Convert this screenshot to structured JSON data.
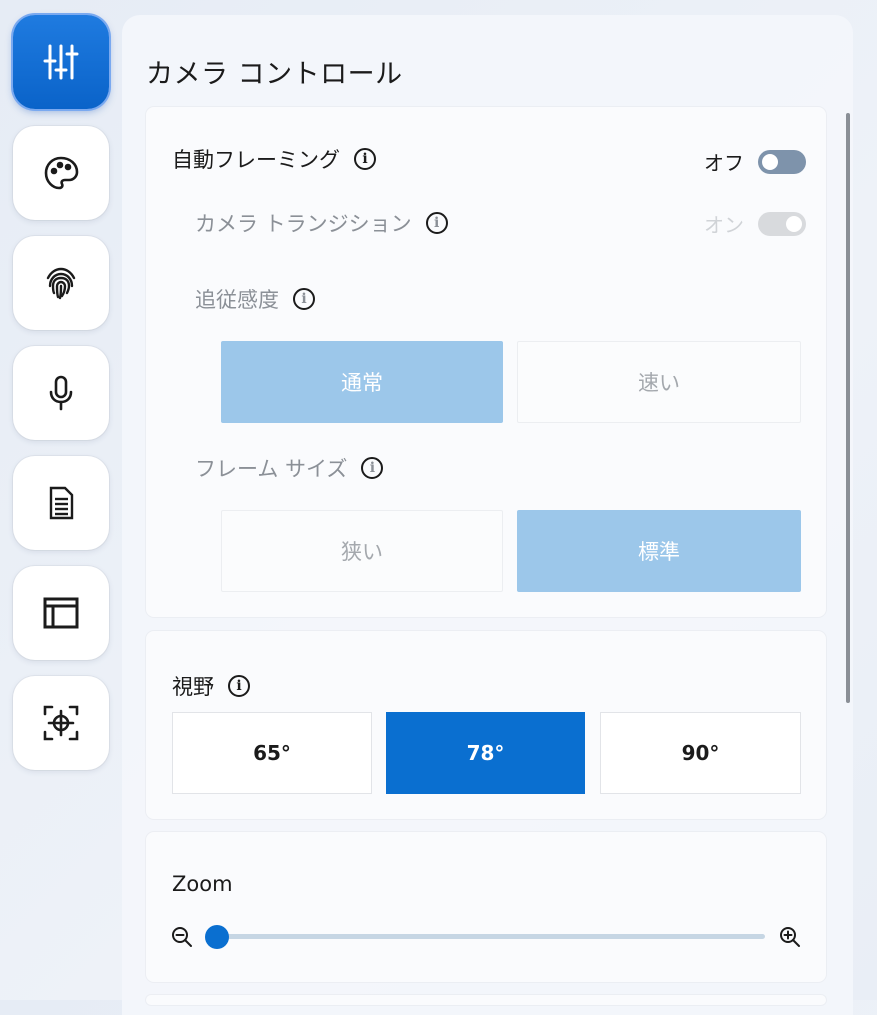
{
  "rail": {
    "items": [
      {
        "icon": "sliders-icon",
        "active": true
      },
      {
        "icon": "palette-icon",
        "active": false
      },
      {
        "icon": "fingerprint-icon",
        "active": false
      },
      {
        "icon": "microphone-icon",
        "active": false
      },
      {
        "icon": "document-icon",
        "active": false
      },
      {
        "icon": "window-layout-icon",
        "active": false
      },
      {
        "icon": "focus-crosshair-icon",
        "active": false
      }
    ]
  },
  "page": {
    "title": "カメラ コントロール"
  },
  "framing": {
    "auto_framing_label": "自動フレーミング",
    "auto_framing_state": "オフ",
    "transition_label": "カメラ トランジション",
    "transition_state": "オン",
    "tracking_label": "追従感度",
    "tracking_options": [
      "通常",
      "速い"
    ],
    "tracking_selected": "通常",
    "frame_size_label": "フレーム サイズ",
    "frame_size_options": [
      "狭い",
      "標準"
    ],
    "frame_size_selected": "標準"
  },
  "fov": {
    "label": "視野",
    "options": [
      "65°",
      "78°",
      "90°"
    ],
    "selected": "78°"
  },
  "zoom": {
    "label": "Zoom",
    "value_fraction": 0.0
  },
  "info_glyph": "i",
  "colors": {
    "accent": "#0a6fd0",
    "accent_light": "#9cc7ea",
    "toggle_off": "#7e93ab"
  }
}
